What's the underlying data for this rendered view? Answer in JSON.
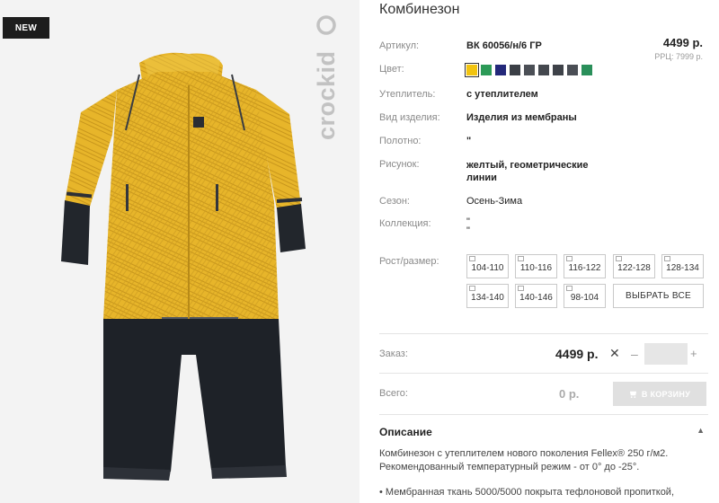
{
  "badge": "NEW",
  "brand": "crockid",
  "product": {
    "title": "Комбинезон",
    "price": "4499 р.",
    "rrp": "РРЦ: 7999 р.",
    "attributes": [
      {
        "label": "Артикул:",
        "value": "ВК 60056/н/6 ГР"
      },
      {
        "label": "Цвет:",
        "value": ""
      },
      {
        "label": "Утеплитель:",
        "value": "с утеплителем"
      },
      {
        "label": "Вид изделия:",
        "value": "Изделия из мембраны"
      },
      {
        "label": "Полотно:",
        "value": "\""
      },
      {
        "label": "Рисунок:",
        "value": "желтый, геометрические линии"
      },
      {
        "label": "Сезон:",
        "value": "Осень-Зима"
      },
      {
        "label": "Коллекция:",
        "value": "\"\n\""
      }
    ],
    "colors": [
      "#f2c40f",
      "#2c9a57",
      "#23287a",
      "#3b3f46",
      "#4b4f56",
      "#44484e",
      "#3e4249",
      "#4a4e55",
      "#2a8f5a"
    ],
    "size_label": "Рост/размер:",
    "sizes": [
      "104-110",
      "110-116",
      "116-122",
      "122-128",
      "128-134",
      "134-140",
      "140-146",
      "98-104"
    ],
    "select_all": "ВЫБРАТЬ ВСЕ"
  },
  "order": {
    "label": "Заказ:",
    "price": "4499 р.",
    "x": "✕",
    "minus": "–",
    "qty": "",
    "plus": "+"
  },
  "total": {
    "label": "Всего:",
    "value": "0 р.",
    "cart": "В КОРЗИНУ"
  },
  "description": {
    "heading": "Описание",
    "text": "Комбинезон с утеплителем нового поколения Fellex® 250 г/м2. Рекомендованный температурный режим - от 0° до -25°.",
    "bullet": "• Мембранная ткань 5000/5000 покрыта тефлоновой пропиткой,"
  },
  "colors_ui": {
    "accent": "#f2c40f",
    "dark": "#1d1d1d"
  }
}
